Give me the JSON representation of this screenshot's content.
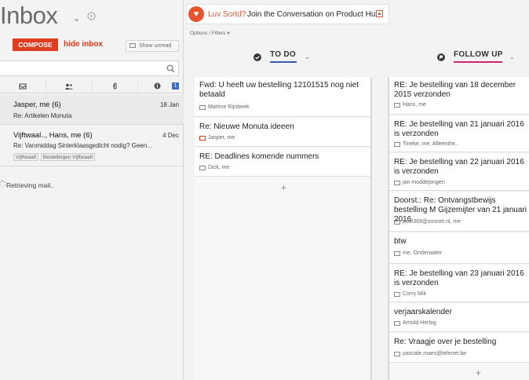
{
  "header": {
    "title": "Inbox",
    "compose": "COMPOSE",
    "hide_inbox": "hide inbox",
    "show_unread": "Show unread"
  },
  "filters": {
    "badge": "1"
  },
  "mails": [
    {
      "from": "Jasper, me (6)",
      "date": "18 Jan",
      "subject": "Re: Artikelen Monuta",
      "tags": []
    },
    {
      "from": "Vijftwaal.., Hans, me (6)",
      "date": "4 Dec",
      "subject": "Re: Vanmiddag Sinterklaasgedicht nodig? Geen...",
      "tags": [
        "Vijftwaalf",
        "Bestellingen Vijftwaalf"
      ]
    }
  ],
  "status": {
    "retrieving": "Retrieving mail.."
  },
  "promo": {
    "strong": "Luv Sortd?",
    "text": "Join the Conversation on Product Hunt"
  },
  "options": "Options / Filters",
  "columns": {
    "todo": {
      "label": "TO DO",
      "cards": [
        {
          "title": "Fwd: U heeft uw bestelling 12101515 nog niet betaald",
          "people": "Martine Rijnbeek"
        },
        {
          "title": "Re: Nieuwe Monuta ideeen",
          "people": "Jasper, me"
        },
        {
          "title": "RE: Deadlines komende nummers",
          "people": "Dick, me"
        }
      ]
    },
    "follow": {
      "label": "FOLLOW UP",
      "cards": [
        {
          "title": "RE: Je bestelling van 18 december 2015 verzonden",
          "people": "Hans, me"
        },
        {
          "title": "RE: Je bestelling van 21 januari 2016 is verzonden",
          "people": "Tineke, me, Alleenthe.."
        },
        {
          "title": "RE: Je bestelling van 22 januari 2016 is verzonden",
          "people": "jan moddejongen"
        },
        {
          "title": "Doorst.: Re: Ontvangstbewijs bestelling M Gijzemijter van 21 januari 2016",
          "people": "post369@zonnet.nl, me"
        },
        {
          "title": "btw",
          "people": "me, Onderwater"
        },
        {
          "title": "RE: Je bestelling van 23 januari 2016 is verzonden",
          "people": "Corry Mik"
        },
        {
          "title": "verjaarskalender",
          "people": "Arnold Herbig"
        },
        {
          "title": "Re: Vraagje over je bestelling",
          "people": "pascale.maes@telenet.be"
        }
      ]
    }
  },
  "colors": {
    "accent": "#e03c1f",
    "todo_underline": "#3b5ba8",
    "follow_underline": "#d0226e"
  }
}
